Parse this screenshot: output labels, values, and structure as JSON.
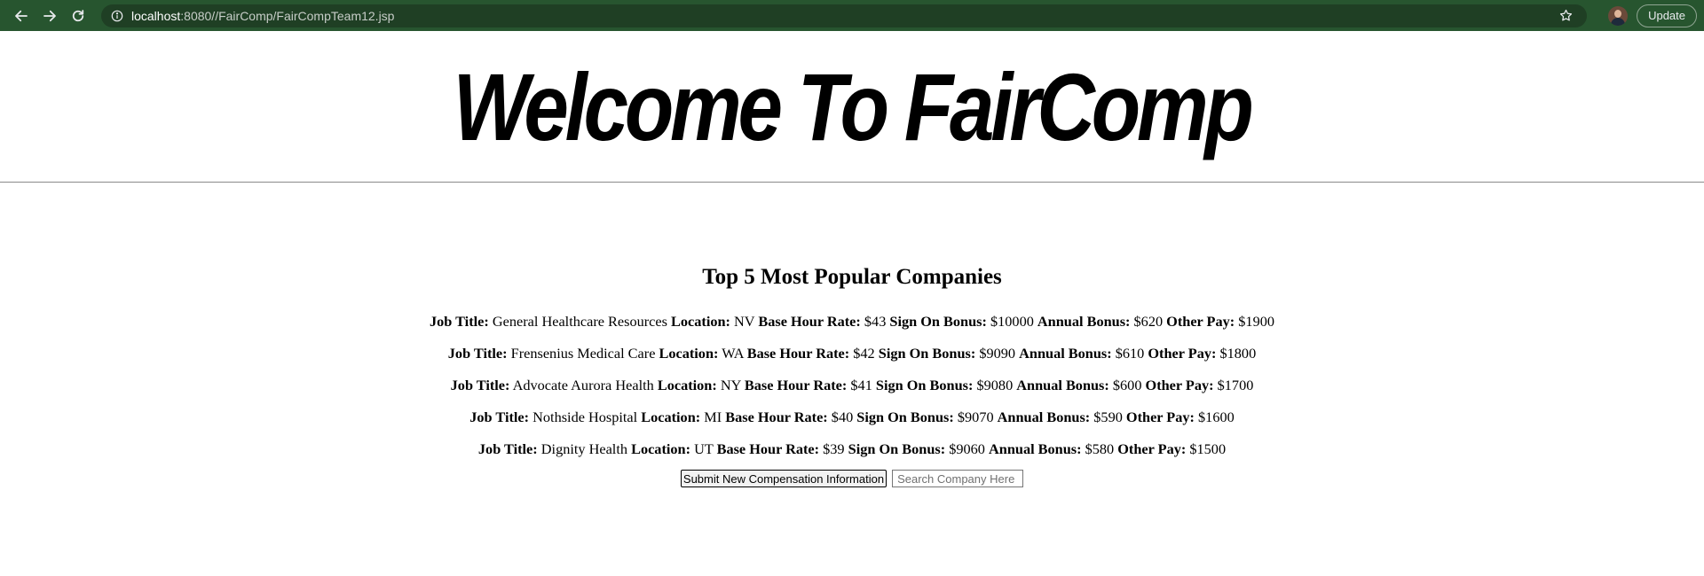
{
  "browser": {
    "url_host": "localhost",
    "url_rest": ":8080//FairComp/FairCompTeam12.jsp",
    "update_label": "Update",
    "icons": [
      "back-arrow-icon",
      "forward-arrow-icon",
      "reload-icon",
      "info-icon",
      "star-icon",
      "avatar"
    ]
  },
  "page": {
    "banner_title": "Welcome To FairComp",
    "section_title": "Top 5 Most Popular Companies",
    "field_labels": {
      "job_title": "Job Title:",
      "location": "Location:",
      "base_rate": "Base Hour Rate:",
      "sign_on": "Sign On Bonus:",
      "annual": "Annual Bonus:",
      "other": "Other Pay:"
    },
    "companies": [
      {
        "job_title": "General Healthcare Resources",
        "location": "NV",
        "base_rate": "$43",
        "sign_on": "$10000",
        "annual": "$620",
        "other": "$1900"
      },
      {
        "job_title": "Frensenius Medical Care",
        "location": "WA",
        "base_rate": "$42",
        "sign_on": "$9090",
        "annual": "$610",
        "other": "$1800"
      },
      {
        "job_title": "Advocate Aurora Health",
        "location": "NY",
        "base_rate": "$41",
        "sign_on": "$9080",
        "annual": "$600",
        "other": "$1700"
      },
      {
        "job_title": "Nothside Hospital",
        "location": "MI",
        "base_rate": "$40",
        "sign_on": "$9070",
        "annual": "$590",
        "other": "$1600"
      },
      {
        "job_title": "Dignity Health",
        "location": "UT",
        "base_rate": "$39",
        "sign_on": "$9060",
        "annual": "$580",
        "other": "$1500"
      }
    ],
    "submit_label": "Submit New Compensation Information",
    "search_placeholder": "Search Company Here"
  }
}
